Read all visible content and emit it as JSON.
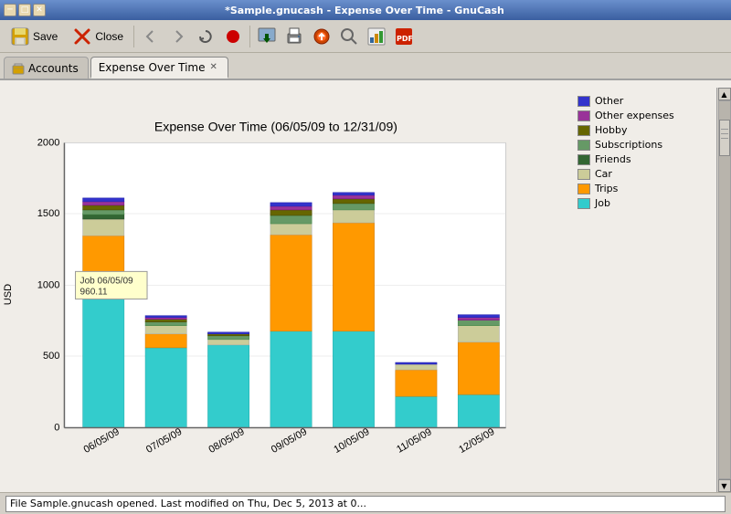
{
  "window": {
    "title": "*Sample.gnucash - Expense Over Time - GnuCash"
  },
  "titlebar_buttons": [
    "─",
    "□",
    "✕"
  ],
  "toolbar": {
    "save_label": "Save",
    "close_label": "Close",
    "buttons": [
      "Save",
      "Close"
    ]
  },
  "tabs": [
    {
      "label": "Accounts",
      "active": false,
      "closable": false
    },
    {
      "label": "Expense Over Time",
      "active": true,
      "closable": true
    }
  ],
  "chart": {
    "title": "Expense Over Time (06/05/09 to 12/31/09)",
    "y_axis_label": "USD",
    "y_max": 2000,
    "y_labels": [
      "2000",
      "1500",
      "1000",
      "500",
      "0"
    ],
    "x_labels": [
      "06/05/09",
      "07/05/09",
      "08/05/09",
      "09/05/09",
      "10/05/09",
      "11/05/09",
      "12/05/09"
    ],
    "tooltip": {
      "date": "Job 06/05/09",
      "value": "960.11"
    },
    "legend": [
      {
        "label": "Other",
        "color": "#3333cc"
      },
      {
        "label": "Other expenses",
        "color": "#993399"
      },
      {
        "label": "Hobby",
        "color": "#666600"
      },
      {
        "label": "Subscriptions",
        "color": "#669966"
      },
      {
        "label": "Friends",
        "color": "#336633"
      },
      {
        "label": "Car",
        "color": "#cccc99"
      },
      {
        "label": "Trips",
        "color": "#ff9900"
      },
      {
        "label": "Job",
        "color": "#33cccc"
      }
    ],
    "bars": [
      {
        "x_label": "06/05/09",
        "segments": [
          {
            "category": "Job",
            "value": 960,
            "color": "#33cccc"
          },
          {
            "category": "Trips",
            "value": 390,
            "color": "#ff9900"
          },
          {
            "category": "Car",
            "value": 120,
            "color": "#cccc99"
          },
          {
            "category": "Friends",
            "value": 40,
            "color": "#336633"
          },
          {
            "category": "Subscriptions",
            "value": 30,
            "color": "#669966"
          },
          {
            "category": "Hobby",
            "value": 30,
            "color": "#666600"
          },
          {
            "category": "Other expenses",
            "value": 25,
            "color": "#993399"
          },
          {
            "category": "Other",
            "value": 25,
            "color": "#3333cc"
          }
        ]
      },
      {
        "x_label": "07/05/09",
        "segments": [
          {
            "category": "Job",
            "value": 560,
            "color": "#33cccc"
          },
          {
            "category": "Trips",
            "value": 100,
            "color": "#ff9900"
          },
          {
            "category": "Car",
            "value": 60,
            "color": "#cccc99"
          },
          {
            "category": "Subscriptions",
            "value": 30,
            "color": "#669966"
          },
          {
            "category": "Hobby",
            "value": 20,
            "color": "#666600"
          },
          {
            "category": "Other expenses",
            "value": 15,
            "color": "#993399"
          },
          {
            "category": "Other",
            "value": 15,
            "color": "#3333cc"
          }
        ]
      },
      {
        "x_label": "08/05/09",
        "segments": [
          {
            "category": "Job",
            "value": 580,
            "color": "#33cccc"
          },
          {
            "category": "Car",
            "value": 40,
            "color": "#cccc99"
          },
          {
            "category": "Subscriptions",
            "value": 25,
            "color": "#669966"
          },
          {
            "category": "Hobby",
            "value": 20,
            "color": "#666600"
          },
          {
            "category": "Other",
            "value": 10,
            "color": "#3333cc"
          }
        ]
      },
      {
        "x_label": "09/05/09",
        "segments": [
          {
            "category": "Job",
            "value": 580,
            "color": "#33cccc"
          },
          {
            "category": "Trips",
            "value": 680,
            "color": "#ff9900"
          },
          {
            "category": "Car",
            "value": 80,
            "color": "#cccc99"
          },
          {
            "category": "Subscriptions",
            "value": 60,
            "color": "#669966"
          },
          {
            "category": "Hobby",
            "value": 40,
            "color": "#666600"
          },
          {
            "category": "Other expenses",
            "value": 30,
            "color": "#993399"
          },
          {
            "category": "Other",
            "value": 25,
            "color": "#3333cc"
          }
        ]
      },
      {
        "x_label": "10/05/09",
        "segments": [
          {
            "category": "Job",
            "value": 570,
            "color": "#33cccc"
          },
          {
            "category": "Trips",
            "value": 760,
            "color": "#ff9900"
          },
          {
            "category": "Car",
            "value": 90,
            "color": "#cccc99"
          },
          {
            "category": "Subscriptions",
            "value": 50,
            "color": "#669966"
          },
          {
            "category": "Hobby",
            "value": 35,
            "color": "#666600"
          },
          {
            "category": "Other expenses",
            "value": 30,
            "color": "#993399"
          },
          {
            "category": "Other",
            "value": 20,
            "color": "#3333cc"
          }
        ]
      },
      {
        "x_label": "11/05/09",
        "segments": [
          {
            "category": "Job",
            "value": 220,
            "color": "#33cccc"
          },
          {
            "category": "Trips",
            "value": 190,
            "color": "#ff9900"
          },
          {
            "category": "Car",
            "value": 50,
            "color": "#cccc99"
          },
          {
            "category": "Other",
            "value": 10,
            "color": "#3333cc"
          }
        ]
      },
      {
        "x_label": "12/05/09",
        "segments": [
          {
            "category": "Job",
            "value": 230,
            "color": "#33cccc"
          },
          {
            "category": "Trips",
            "value": 370,
            "color": "#ff9900"
          },
          {
            "category": "Car",
            "value": 120,
            "color": "#cccc99"
          },
          {
            "category": "Subscriptions",
            "value": 40,
            "color": "#669966"
          },
          {
            "category": "Other expenses",
            "value": 20,
            "color": "#993399"
          },
          {
            "category": "Other",
            "value": 20,
            "color": "#3333cc"
          }
        ]
      }
    ]
  },
  "status_bar": {
    "text": "File Sample.gnucash opened. Last modified on Thu, Dec  5, 2013 at 0..."
  }
}
